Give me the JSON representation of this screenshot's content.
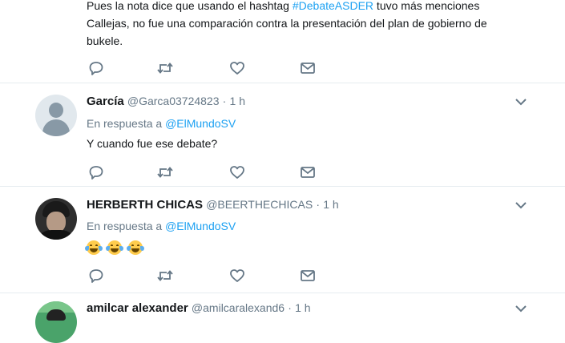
{
  "tweets": [
    {
      "text_lines": [
        "Pues la nota dice que usando el hashtag ",
        "#DebateASDER",
        " tuvo más menciones",
        "Callejas, no fue una comparación contra la presentación del plan de gobierno de",
        "bukele."
      ]
    },
    {
      "name": "García",
      "handle": "@Garca03724823",
      "dot": "·",
      "time": "1 h",
      "reply_prefix": "En respuesta a",
      "reply_mention": "@ElMundoSV",
      "text": "Y cuando fue ese debate?"
    },
    {
      "name": "HERBERTH CHICAS",
      "handle": "@BEERTHECHICAS",
      "dot": "·",
      "time": "1 h",
      "reply_prefix": "En respuesta a",
      "reply_mention": "@ElMundoSV",
      "emojis": [
        "face-with-tears-of-joy",
        "face-with-tears-of-joy",
        "face-with-tears-of-joy"
      ]
    },
    {
      "name": "amilcar alexander",
      "handle": "@amilcaralexand6",
      "dot": "·",
      "time": "1 h"
    }
  ],
  "icons": {
    "reply": "reply-icon",
    "retweet": "retweet-icon",
    "like": "like-icon",
    "dm": "direct-message-icon",
    "more": "chevron-down-icon"
  },
  "colors": {
    "link": "#1da1f2",
    "muted": "#657786",
    "divider": "#e6ecf0"
  }
}
